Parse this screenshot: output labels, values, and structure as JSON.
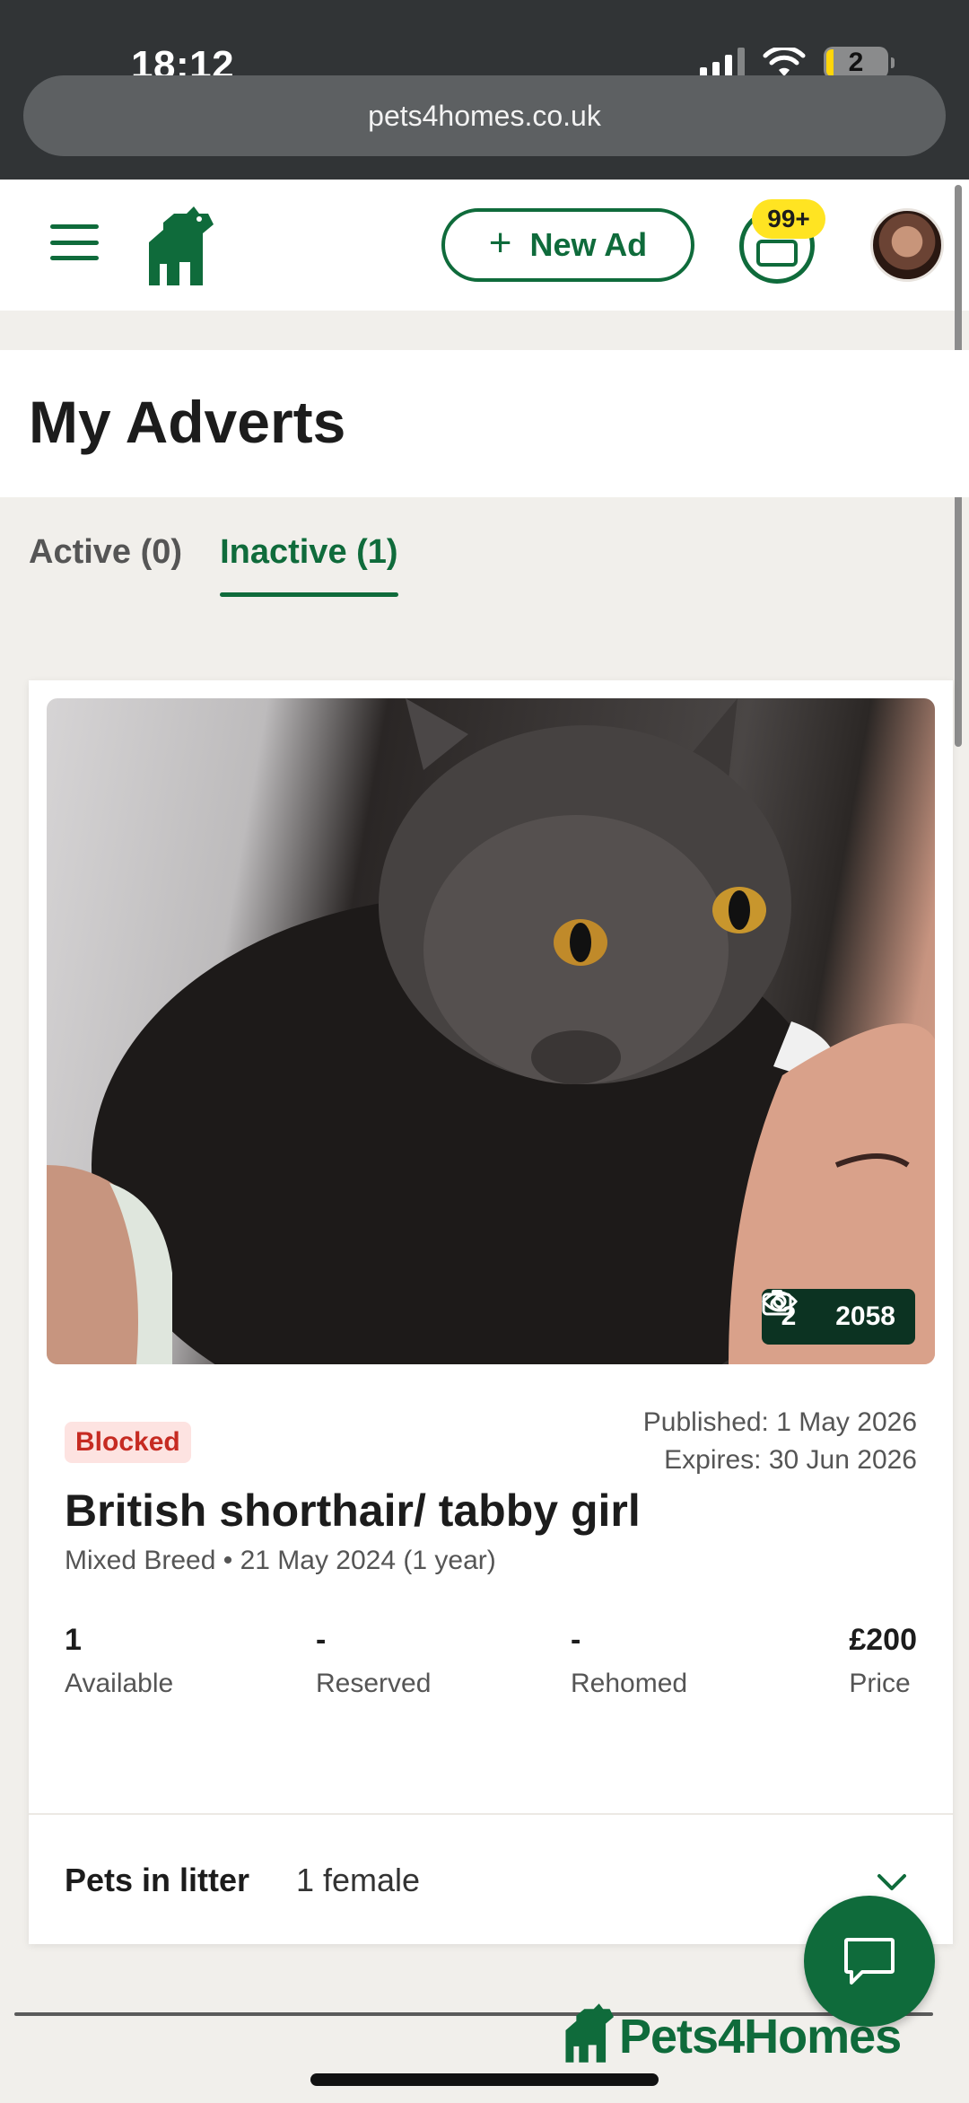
{
  "status_bar": {
    "time": "18:12",
    "battery": "2"
  },
  "browser": {
    "url": "pets4homes.co.uk"
  },
  "header": {
    "new_ad_label": "New Ad",
    "messages_badge": "99+"
  },
  "page": {
    "title": "My Adverts"
  },
  "tabs": [
    {
      "label": "Active (0)",
      "active": false
    },
    {
      "label": "Inactive (1)",
      "active": true
    }
  ],
  "advert": {
    "photo_count": "2",
    "view_count": "2058",
    "status": "Blocked",
    "published": "Published: 1 May 2026",
    "expires": "Expires: 30 Jun 2026",
    "title": "British shorthair/ tabby girl",
    "subtitle": "Mixed Breed • 21 May 2024 (1 year)",
    "stats": {
      "available": {
        "value": "1",
        "label": "Available"
      },
      "reserved": {
        "value": "-",
        "label": "Reserved"
      },
      "rehomed": {
        "value": "-",
        "label": "Rehomed"
      },
      "price": {
        "value": "£200",
        "label": "Price"
      }
    },
    "litter": {
      "label": "Pets in litter",
      "value": "1 female"
    }
  },
  "footer": {
    "brand": "Pets4Homes"
  },
  "colors": {
    "brand_green": "#0f6b3b",
    "badge_yellow": "#ffe422",
    "blocked_red": "#c62b22"
  }
}
